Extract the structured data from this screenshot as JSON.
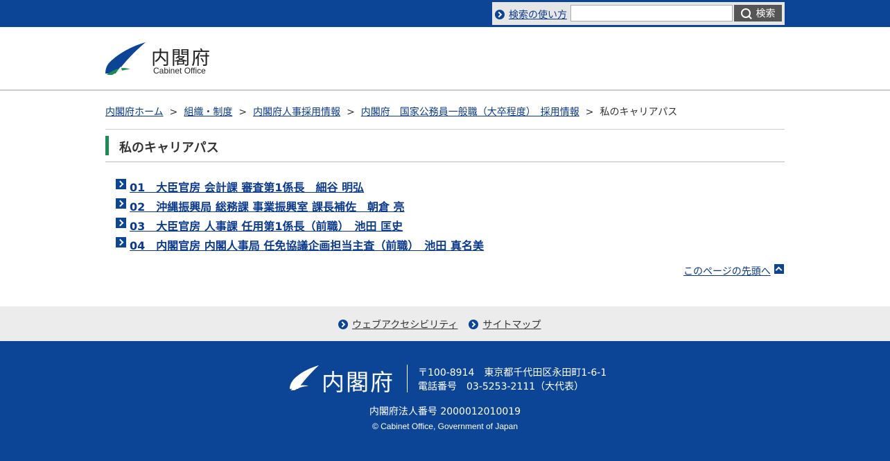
{
  "search": {
    "help_label": "検索の使い方",
    "input_value": "",
    "placeholder": "",
    "button_label": "検索"
  },
  "logo": {
    "name_jp": "内閣府",
    "name_en": "Cabinet Office"
  },
  "breadcrumb": {
    "items": [
      "内閣府ホーム",
      "組織・制度",
      "内閣府人事採用情報",
      "内閣府　国家公務員一般職（大卒程度）　採用情報"
    ],
    "current": "私のキャリアパス",
    "separator": ">"
  },
  "page": {
    "title": "私のキャリアパス",
    "links": [
      "01　大臣官房 会計課 審査第1係長　細谷 明弘",
      "02　沖縄振興局 総務課 事業振興室 課長補佐　朝倉 亮",
      "03　大臣官房 人事課 任用第1係長（前職）　池田 匡史",
      "04　内閣官房 内閣人事局 任免協議企画担当主査（前職）　池田 真名美"
    ],
    "pagetop_label": "このページの先頭へ"
  },
  "footer_nav": {
    "accessibility": "ウェブアクセシビリティ",
    "sitemap": "サイトマップ"
  },
  "footer": {
    "logo_text": "内閣府",
    "address": "〒100-8914　東京都千代田区永田町1-6-1",
    "phone": "電話番号　03-5253-2111（大代表）",
    "corporate_number": "内閣府法人番号 2000012010019",
    "copyright": "© Cabinet Office, Government of Japan"
  },
  "colors": {
    "brand_blue": "#0c4596",
    "title_accent": "#1e8a55",
    "footer_nav_bg": "#ececec"
  }
}
